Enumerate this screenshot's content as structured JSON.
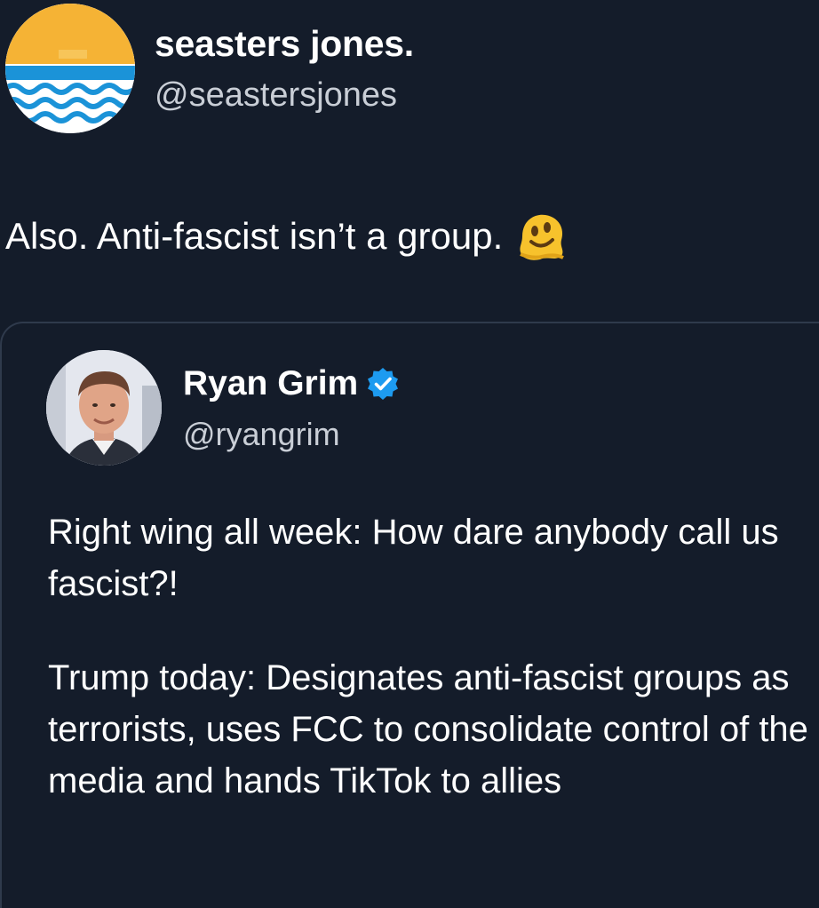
{
  "tweet": {
    "author": {
      "name": "seasters jones.",
      "handle": "@seastersjones",
      "avatar_icon": "sunset-waves-avatar"
    },
    "text": "Also. Anti-fascist isn’t a group.",
    "emoji": "melting-face-emoji"
  },
  "quoted_tweet": {
    "author": {
      "name": "Ryan Grim",
      "handle": "@ryangrim",
      "verified": true,
      "avatar_icon": "profile-photo"
    },
    "paragraphs": [
      "Right wing all week: How dare anybody call us fascist?!",
      "Trump today: Designates anti-fascist groups as terrorists, uses FCC to consolidate control of the media and hands TikTok to allies"
    ]
  },
  "colors": {
    "background": "#141c2a",
    "text": "#ffffff",
    "secondary_text": "#c9ced6",
    "verified_badge": "#1d9bf0",
    "avatar_sun": "#f5b335",
    "avatar_water": "#1b93d8"
  }
}
